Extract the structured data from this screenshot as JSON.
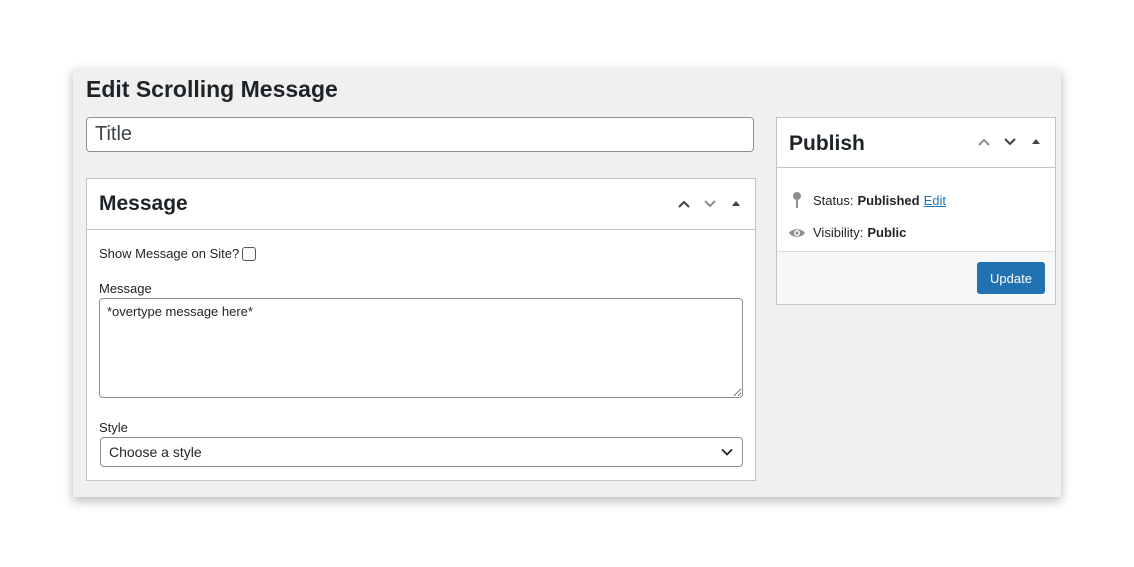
{
  "page": {
    "title": "Edit Scrolling Message"
  },
  "title_field": {
    "placeholder": "Title",
    "value": ""
  },
  "message_box": {
    "heading": "Message",
    "show_label": "Show Message on Site?",
    "show_checked": false,
    "message_label": "Message",
    "message_value": "*overtype message here*",
    "style_label": "Style",
    "style_selected": "Choose a style"
  },
  "publish_box": {
    "heading": "Publish",
    "status_label": "Status:",
    "status_value": "Published",
    "edit_link": "Edit",
    "visibility_label": "Visibility:",
    "visibility_value": "Public",
    "update_button": "Update"
  },
  "icons": {
    "move_up": "chevron-up-icon",
    "move_down": "chevron-down-icon",
    "toggle": "triangle-up-icon",
    "status": "pin-icon",
    "visibility": "eye-icon",
    "select_arrow": "chevron-down-icon"
  },
  "colors": {
    "accent": "#2271b1",
    "background": "#f0f0f1",
    "border": "#c3c4c7"
  }
}
